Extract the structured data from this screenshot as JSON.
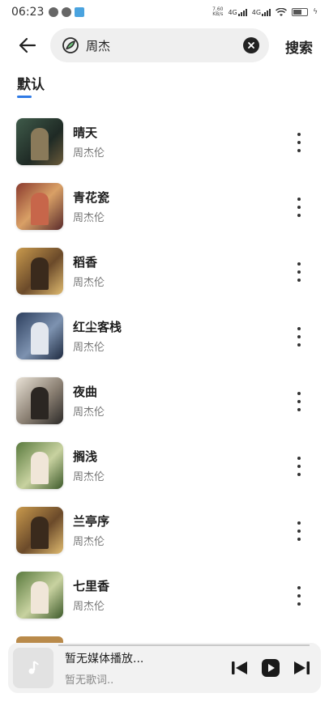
{
  "status": {
    "time": "06:23",
    "net_speed": "7.60\nKB/s",
    "signal1": "4G",
    "signal2": "4G"
  },
  "search": {
    "value": "周杰",
    "button_label": "搜索"
  },
  "tab": {
    "label": "默认"
  },
  "songs": [
    {
      "title": "晴天",
      "artist": "周杰伦"
    },
    {
      "title": "青花瓷",
      "artist": "周杰伦"
    },
    {
      "title": "稻香",
      "artist": "周杰伦"
    },
    {
      "title": "红尘客栈",
      "artist": "周杰伦"
    },
    {
      "title": "夜曲",
      "artist": "周杰伦"
    },
    {
      "title": "搁浅",
      "artist": "周杰伦"
    },
    {
      "title": "兰亭序",
      "artist": "周杰伦"
    },
    {
      "title": "七里香",
      "artist": "周杰伦"
    }
  ],
  "player": {
    "title": "暂无媒体播放...",
    "lyric": "暂无歌词.."
  },
  "colors": {
    "accent": "#2f7ae5",
    "search_bg": "#efefef",
    "player_bg": "#f2f2f2"
  },
  "icons": {
    "back": "back-arrow-icon",
    "search_logo": "leaf-logo-icon",
    "clear": "clear-icon",
    "more": "more-vertical-icon",
    "prev": "skip-previous-icon",
    "play": "play-icon",
    "next": "skip-next-icon",
    "music": "music-note-icon"
  }
}
